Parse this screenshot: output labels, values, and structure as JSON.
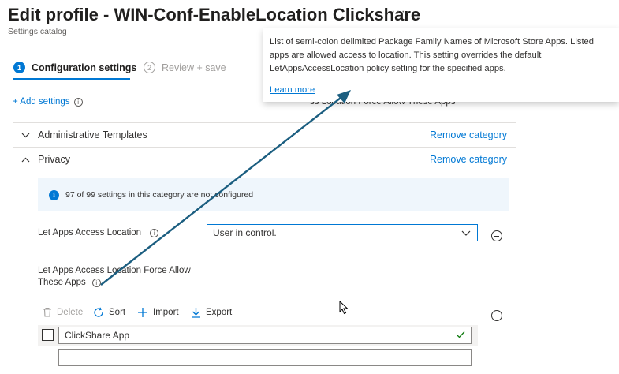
{
  "header": {
    "title": "Edit profile - WIN-Conf-EnableLocation Clickshare",
    "more_label": "···",
    "subtitle": "Settings catalog"
  },
  "steps": [
    {
      "number": "1",
      "label": "Configuration settings",
      "active": true
    },
    {
      "number": "2",
      "label": "Review + save",
      "active": false
    }
  ],
  "add_settings": {
    "label": "+ Add settings",
    "info": "i"
  },
  "peek_text": "ss Location Force Allow These Apps",
  "categories": [
    {
      "name": "Administrative Templates",
      "remove_label": "Remove category",
      "expanded": false
    },
    {
      "name": "Privacy",
      "remove_label": "Remove category",
      "expanded": true
    }
  ],
  "info_bar": {
    "icon": "i",
    "text": "97 of 99 settings in this category are not configured"
  },
  "settings": {
    "access_location": {
      "label": "Let Apps Access Location",
      "info": "i",
      "selected_value": "User in control."
    },
    "force_allow": {
      "label_line1": "Let Apps Access Location Force Allow",
      "label_line2": "These Apps",
      "info": "i"
    }
  },
  "toolbar": {
    "delete_label": "Delete",
    "sort_label": "Sort",
    "import_label": "Import",
    "export_label": "Export"
  },
  "list_items": [
    {
      "value": "ClickShare App",
      "valid": true
    },
    {
      "value": "",
      "valid": false
    }
  ],
  "tooltip": {
    "description": "List of semi-colon delimited Package Family Names of Microsoft Store Apps. Listed apps are allowed access to location. This setting overrides the default LetAppsAccessLocation policy setting for the specified apps.",
    "learn_more": "Learn more"
  },
  "colors": {
    "accent": "#0078d4",
    "annotation_arrow": "#1b5e80",
    "valid_check": "#107c10",
    "info_bar_bg": "#eff6fc"
  }
}
